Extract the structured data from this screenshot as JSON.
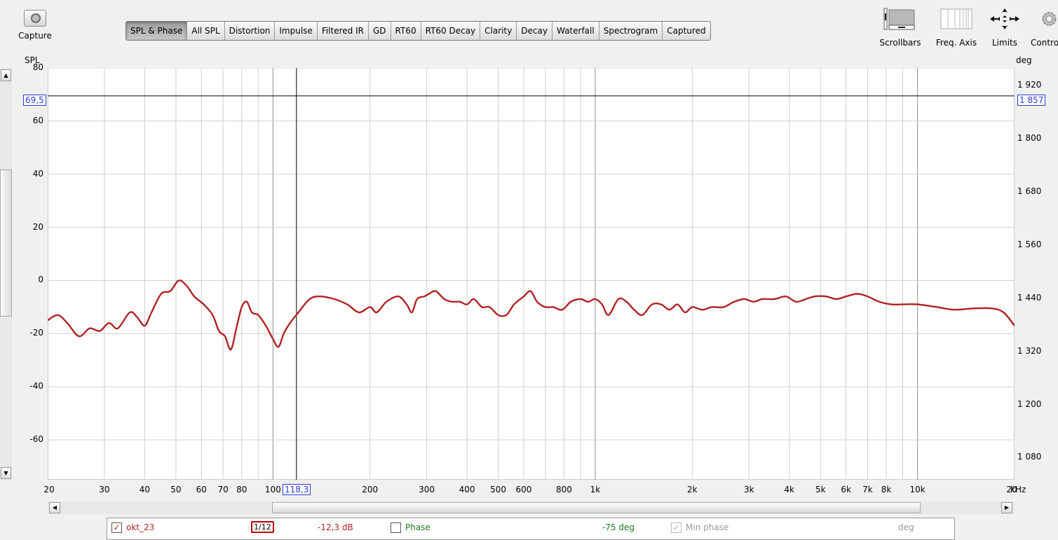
{
  "toolbar": {
    "capture_label": "Capture",
    "tabs": [
      {
        "label": "SPL & Phase",
        "active": true
      },
      {
        "label": "All SPL"
      },
      {
        "label": "Distortion"
      },
      {
        "label": "Impulse"
      },
      {
        "label": "Filtered IR"
      },
      {
        "label": "GD"
      },
      {
        "label": "RT60"
      },
      {
        "label": "RT60 Decay"
      },
      {
        "label": "Clarity"
      },
      {
        "label": "Decay"
      },
      {
        "label": "Waterfall"
      },
      {
        "label": "Spectrogram"
      },
      {
        "label": "Captured"
      }
    ],
    "tools": {
      "scrollbars": "Scrollbars",
      "freq_axis": "Freq. Axis",
      "limits": "Limits",
      "controls": "Controls"
    }
  },
  "graph": {
    "left_axis_title": "SPL",
    "right_axis_title": "deg",
    "cursor_y_left": "69,5",
    "cursor_y_right": "1 857",
    "cursor_x": "118,3",
    "x_unit": "kHz"
  },
  "chart_data": {
    "type": "line",
    "x_scale": "log",
    "xlim": [
      20,
      20000
    ],
    "ylim": [
      -75,
      80
    ],
    "y_right_lim": [
      1030,
      1960
    ],
    "y_ticks": [
      80,
      60,
      40,
      20,
      0,
      -20,
      -40,
      -60
    ],
    "y_right_ticks": [
      "1 920",
      "1 800",
      "1 680",
      "1 560",
      "1 440",
      "1 320",
      "1 200",
      "1 080"
    ],
    "x_tick_labels": [
      {
        "v": 20,
        "t": "20"
      },
      {
        "v": 30,
        "t": "30"
      },
      {
        "v": 40,
        "t": "40"
      },
      {
        "v": 50,
        "t": "50"
      },
      {
        "v": 60,
        "t": "60"
      },
      {
        "v": 70,
        "t": "70"
      },
      {
        "v": 80,
        "t": "80"
      },
      {
        "v": 100,
        "t": "100"
      },
      {
        "v": 200,
        "t": "200"
      },
      {
        "v": 300,
        "t": "300"
      },
      {
        "v": 400,
        "t": "400"
      },
      {
        "v": 500,
        "t": "500"
      },
      {
        "v": 600,
        "t": "600"
      },
      {
        "v": 800,
        "t": "800"
      },
      {
        "v": 1000,
        "t": "1k"
      },
      {
        "v": 2000,
        "t": "2k"
      },
      {
        "v": 3000,
        "t": "3k"
      },
      {
        "v": 4000,
        "t": "4k"
      },
      {
        "v": 5000,
        "t": "5k"
      },
      {
        "v": 6000,
        "t": "6k"
      },
      {
        "v": 7000,
        "t": "7k"
      },
      {
        "v": 8000,
        "t": "8k"
      },
      {
        "v": 10000,
        "t": "10k"
      },
      {
        "v": 20000,
        "t": "20"
      }
    ],
    "cursor": {
      "x": 118.3,
      "y": 69.5
    },
    "grid": true,
    "series": [
      {
        "name": "okt_23",
        "color": "#b22222",
        "points": [
          [
            20,
            -15
          ],
          [
            21.5,
            -13
          ],
          [
            23,
            -16
          ],
          [
            25,
            -21
          ],
          [
            27,
            -18
          ],
          [
            29,
            -19
          ],
          [
            31,
            -16
          ],
          [
            33,
            -18
          ],
          [
            36,
            -12
          ],
          [
            38,
            -14
          ],
          [
            40,
            -17
          ],
          [
            42,
            -12
          ],
          [
            45,
            -5
          ],
          [
            48,
            -4
          ],
          [
            51,
            0
          ],
          [
            54,
            -2
          ],
          [
            57,
            -6
          ],
          [
            61,
            -9
          ],
          [
            65,
            -13
          ],
          [
            68,
            -19
          ],
          [
            71,
            -21
          ],
          [
            74,
            -26
          ],
          [
            77,
            -18
          ],
          [
            80,
            -10
          ],
          [
            83,
            -8
          ],
          [
            86,
            -12
          ],
          [
            90,
            -13
          ],
          [
            95,
            -17
          ],
          [
            100,
            -22
          ],
          [
            104,
            -25
          ],
          [
            108,
            -20
          ],
          [
            113,
            -16
          ],
          [
            120,
            -12
          ],
          [
            130,
            -7
          ],
          [
            140,
            -6
          ],
          [
            155,
            -7
          ],
          [
            170,
            -9
          ],
          [
            185,
            -12
          ],
          [
            200,
            -10
          ],
          [
            210,
            -12
          ],
          [
            225,
            -8
          ],
          [
            245,
            -6
          ],
          [
            260,
            -9
          ],
          [
            270,
            -12
          ],
          [
            280,
            -7
          ],
          [
            295,
            -6
          ],
          [
            305,
            -5
          ],
          [
            320,
            -4
          ],
          [
            340,
            -7
          ],
          [
            360,
            -8
          ],
          [
            380,
            -8
          ],
          [
            400,
            -9
          ],
          [
            420,
            -7
          ],
          [
            445,
            -10
          ],
          [
            470,
            -10
          ],
          [
            500,
            -13
          ],
          [
            530,
            -13
          ],
          [
            560,
            -9
          ],
          [
            600,
            -6
          ],
          [
            630,
            -4
          ],
          [
            660,
            -8
          ],
          [
            700,
            -10
          ],
          [
            740,
            -10
          ],
          [
            790,
            -11
          ],
          [
            840,
            -8
          ],
          [
            900,
            -7
          ],
          [
            950,
            -8
          ],
          [
            1000,
            -7
          ],
          [
            1050,
            -9
          ],
          [
            1100,
            -13
          ],
          [
            1180,
            -7
          ],
          [
            1250,
            -8
          ],
          [
            1320,
            -11
          ],
          [
            1400,
            -13
          ],
          [
            1500,
            -9
          ],
          [
            1600,
            -9
          ],
          [
            1700,
            -11
          ],
          [
            1800,
            -9
          ],
          [
            1900,
            -12
          ],
          [
            2000,
            -10
          ],
          [
            2150,
            -11
          ],
          [
            2300,
            -10
          ],
          [
            2500,
            -10
          ],
          [
            2700,
            -8
          ],
          [
            2900,
            -7
          ],
          [
            3100,
            -8
          ],
          [
            3300,
            -7
          ],
          [
            3600,
            -7
          ],
          [
            3900,
            -6
          ],
          [
            4200,
            -8
          ],
          [
            4500,
            -7
          ],
          [
            4800,
            -6
          ],
          [
            5200,
            -6
          ],
          [
            5600,
            -7
          ],
          [
            6000,
            -6
          ],
          [
            6500,
            -5
          ],
          [
            7000,
            -6
          ],
          [
            7600,
            -8
          ],
          [
            8300,
            -9
          ],
          [
            9000,
            -9
          ],
          [
            10000,
            -9
          ],
          [
            11500,
            -10
          ],
          [
            13000,
            -11
          ],
          [
            15000,
            -10.5
          ],
          [
            17000,
            -10.5
          ],
          [
            18500,
            -12
          ],
          [
            20000,
            -17
          ]
        ]
      }
    ]
  },
  "legend": {
    "trace_name": "okt_23",
    "smoothing": "1/12",
    "offset": "-12,3 dB",
    "phase_label": "Phase",
    "phase_value": "-75 deg",
    "min_phase_label": "Min phase",
    "min_phase_unit": "deg"
  },
  "colors": {
    "trace": "#b22222",
    "cursor_box": "#2b3bd8",
    "plot_bg": "#ffffff",
    "grid": "#c8c8c8"
  }
}
